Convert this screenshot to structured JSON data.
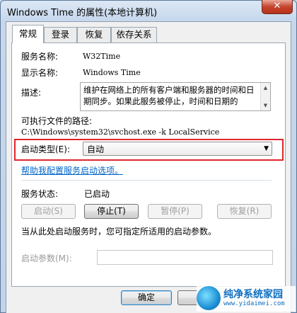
{
  "window": {
    "title": "Windows Time 的属性(本地计算机)",
    "close_glyph": "✕"
  },
  "tabs": [
    {
      "label": "常规",
      "active": true
    },
    {
      "label": "登录",
      "active": false
    },
    {
      "label": "恢复",
      "active": false
    },
    {
      "label": "依存关系",
      "active": false
    }
  ],
  "general": {
    "service_name_label": "服务名称:",
    "service_name": "W32Time",
    "display_name_label": "显示名称:",
    "display_name": "Windows Time",
    "description_label": "描述:",
    "description": "维护在网络上的所有客户端和服务器的时间和日期同步。如果此服务被停止，时间和日期的",
    "exe_path_label": "可执行文件的路径:",
    "exe_path": "C:\\Windows\\system32\\svchost.exe -k LocalService",
    "startup_type_label": "启动类型(E):",
    "startup_type_value": "自动",
    "startup_help_link": "帮助我配置服务启动选项。",
    "status_label": "服务状态:",
    "status_value": "已启动",
    "buttons": {
      "start": "启动(S)",
      "stop": "停止(T)",
      "pause": "暂停(P)",
      "resume": "恢复(R)"
    },
    "start_params_hint": "当从此处启动服务时，您可指定所适用的启动参数。",
    "start_params_label": "启动参数(M):",
    "start_params_value": ""
  },
  "footer": {
    "ok": "确定"
  },
  "watermark": {
    "name": "纯净系统家园",
    "url": "www.yidaimei.com"
  },
  "colors": {
    "highlight": "#e0262c",
    "link": "#0066cc",
    "close_button": "#c5442d"
  }
}
